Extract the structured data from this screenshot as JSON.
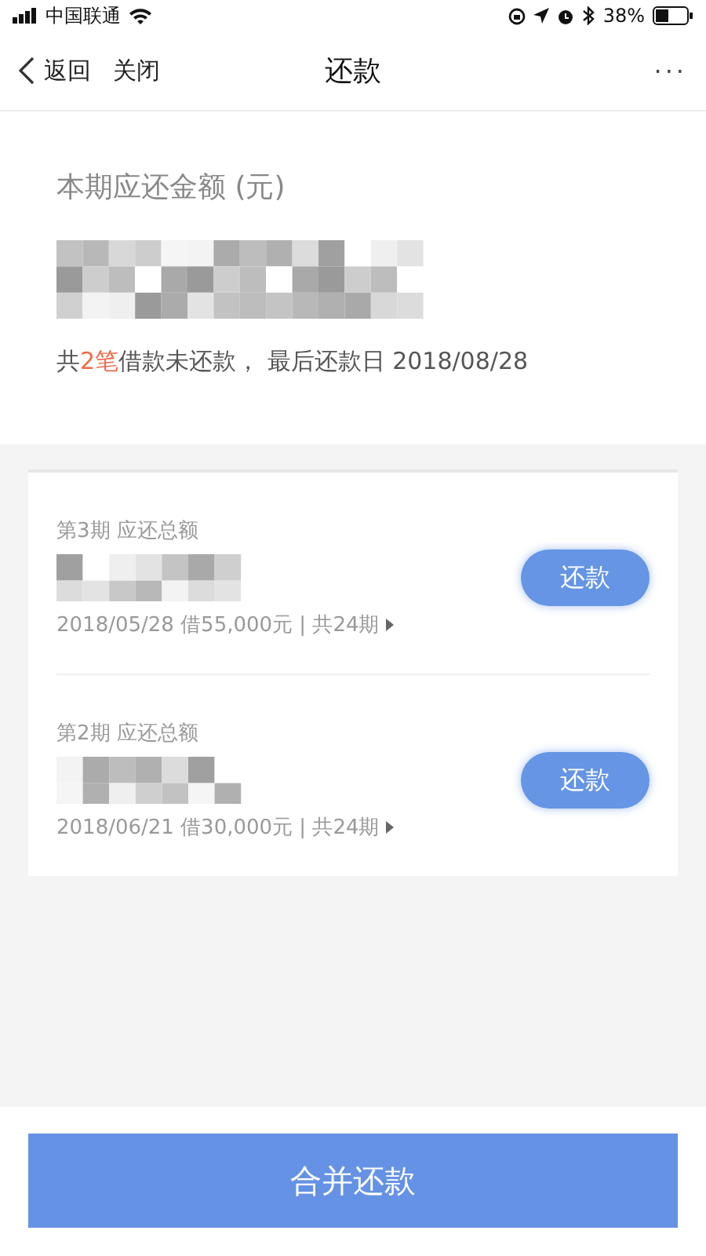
{
  "status_bar": {
    "carrier": "中国联通",
    "battery": "38%"
  },
  "nav": {
    "back": "返回",
    "close": "关闭",
    "title": "还款",
    "more": "···"
  },
  "summary": {
    "label": "本期应还金额 (元)",
    "text_before": "共",
    "count": "2笔",
    "text_after": "借款未还款， 最后还款日 2018/08/28"
  },
  "loans": [
    {
      "period": "第3期 应还总额",
      "detail": "2018/05/28 借55,000元 | 共24期",
      "button": "还款"
    },
    {
      "period": "第2期 应还总额",
      "detail": "2018/06/21 借30,000元 | 共24期",
      "button": "还款"
    }
  ],
  "footer": {
    "button": "合并还款"
  }
}
